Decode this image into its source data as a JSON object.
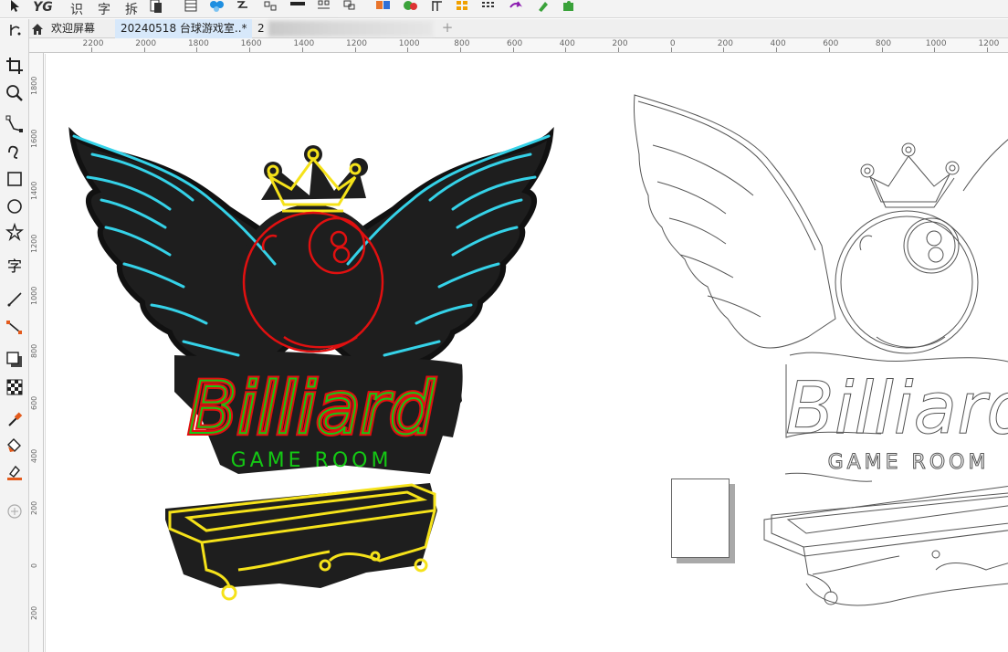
{
  "toolbar": {
    "items": [
      {
        "name": "pick-tool-icon"
      },
      {
        "name": "ai-icon",
        "label": "YG"
      },
      {
        "name": "text-recognition-button",
        "label": "识"
      },
      {
        "name": "text-button",
        "label": "字"
      },
      {
        "name": "split-button",
        "label": "拆"
      },
      {
        "name": "page-icon"
      },
      {
        "name": "table-icon"
      },
      {
        "name": "blend-icon"
      },
      {
        "name": "trace-icon"
      },
      {
        "name": "brush-icon"
      },
      {
        "name": "align-icon"
      },
      {
        "name": "group-icon"
      },
      {
        "name": "color-icon"
      },
      {
        "name": "image-icon"
      },
      {
        "name": "text-format-icon"
      },
      {
        "name": "grid-icon"
      },
      {
        "name": "dots-icon"
      },
      {
        "name": "redo-icon"
      },
      {
        "name": "pen-icon"
      },
      {
        "name": "plugin-icon"
      }
    ]
  },
  "tabs": {
    "welcome": "欢迎屏幕",
    "document": "20240518 台球游戏室..*",
    "document2": "2",
    "add": "+"
  },
  "ruler": {
    "corner": "ㅊ",
    "h_labels": [
      "2200",
      "2000",
      "1800",
      "1600",
      "1400",
      "1200",
      "1000",
      "800",
      "600",
      "400",
      "200",
      "0",
      "200",
      "400",
      "600",
      "800",
      "1000",
      "1200"
    ],
    "v_labels": [
      "1800",
      "1600",
      "1400",
      "1200",
      "1000",
      "800",
      "600",
      "400",
      "200",
      "0",
      "200"
    ]
  },
  "toolbox": [
    {
      "name": "pick-tool-icon"
    },
    {
      "name": "crop-tool-icon"
    },
    {
      "name": "zoom-tool-icon"
    },
    {
      "name": "bezier-tool-icon"
    },
    {
      "name": "freehand-tool-icon"
    },
    {
      "name": "rectangle-tool-icon"
    },
    {
      "name": "ellipse-tool-icon"
    },
    {
      "name": "star-tool-icon"
    },
    {
      "name": "text-tool-icon",
      "label": "字"
    },
    {
      "name": "parallel-dimension-tool-icon"
    },
    {
      "name": "connector-tool-icon"
    },
    {
      "name": "drop-shadow-tool-icon"
    },
    {
      "name": "transparency-tool-icon"
    },
    {
      "name": "eyedropper-tool-icon"
    },
    {
      "name": "fill-tool-icon"
    },
    {
      "name": "smart-fill-tool-icon"
    },
    {
      "name": "add-tool-icon"
    }
  ],
  "artwork": {
    "title": "Billiard",
    "subtitle": "GAME ROOM",
    "colors": {
      "wing": "#35d2e8",
      "ball": "#e01010",
      "text_outer": "#e01010",
      "text_inner": "#14c814",
      "crown": "#f5e21a",
      "table": "#f5e21a",
      "base": "#1e1e1e",
      "outline": "#555555"
    }
  }
}
